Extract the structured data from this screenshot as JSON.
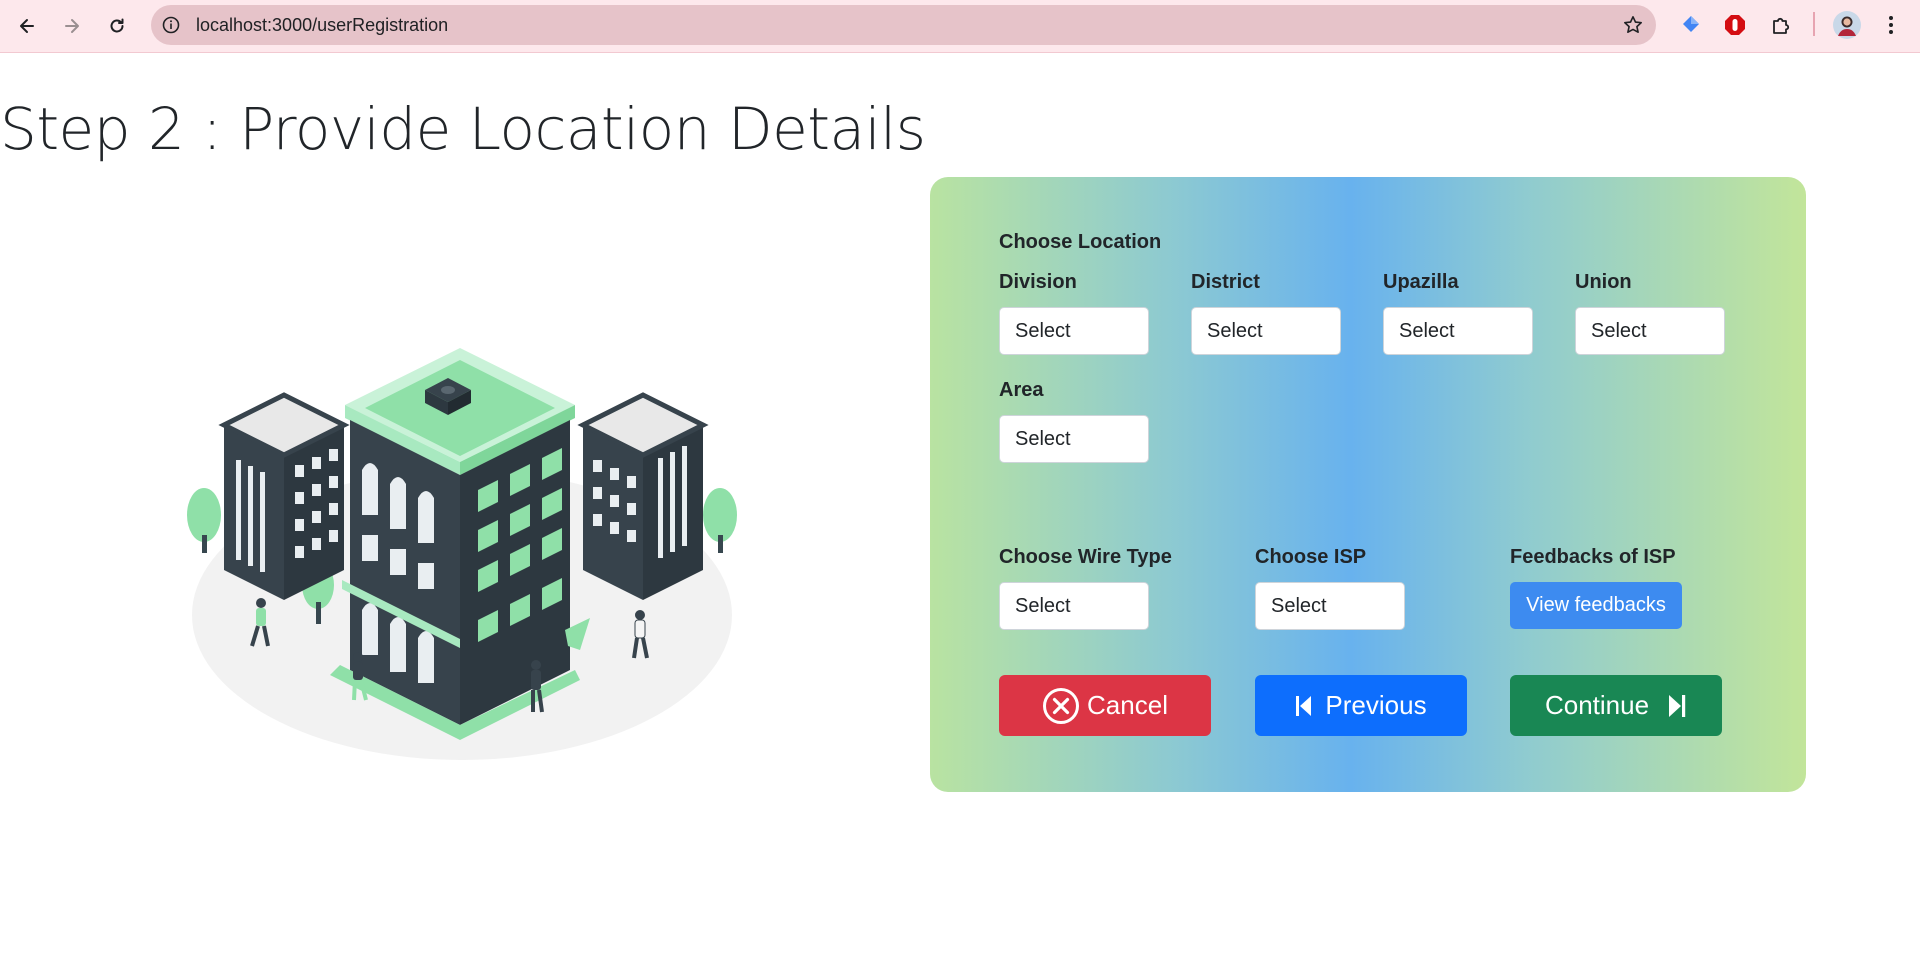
{
  "browser": {
    "url": "localhost:3000/userRegistration"
  },
  "page": {
    "title": "Step 2 : Provide Location Details"
  },
  "form": {
    "location_section_label": "Choose Location",
    "location_fields": [
      {
        "label": "Division",
        "value": "Select"
      },
      {
        "label": "District",
        "value": "Select"
      },
      {
        "label": "Upazilla",
        "value": "Select"
      },
      {
        "label": "Union",
        "value": "Select"
      },
      {
        "label": "Area",
        "value": "Select"
      }
    ],
    "wire_type": {
      "label": "Choose Wire Type",
      "value": "Select"
    },
    "isp": {
      "label": "Choose ISP",
      "value": "Select"
    },
    "feedbacks": {
      "label": "Feedbacks of ISP",
      "button_label": "View feedbacks"
    },
    "buttons": {
      "cancel": "Cancel",
      "previous": "Previous",
      "continue": "Continue"
    }
  },
  "colors": {
    "cancel": "#dc3545",
    "previous": "#0d6efd",
    "continue": "#198754",
    "feedback_button": "#3d8bf0",
    "browser_bar": "#fde8ec",
    "omnibox": "#e6c3c9"
  },
  "icons": {
    "back": "arrow-left-icon",
    "forward": "arrow-right-icon",
    "reload": "reload-icon",
    "site_info": "info-icon",
    "bookmark": "star-icon",
    "extensions": [
      "diamond-extension-icon",
      "stop-hand-extension-icon",
      "puzzle-icon",
      "avatar",
      "kebab-menu-icon"
    ],
    "cancel": "circle-x-icon",
    "previous": "skip-back-icon",
    "continue": "skip-forward-icon"
  }
}
